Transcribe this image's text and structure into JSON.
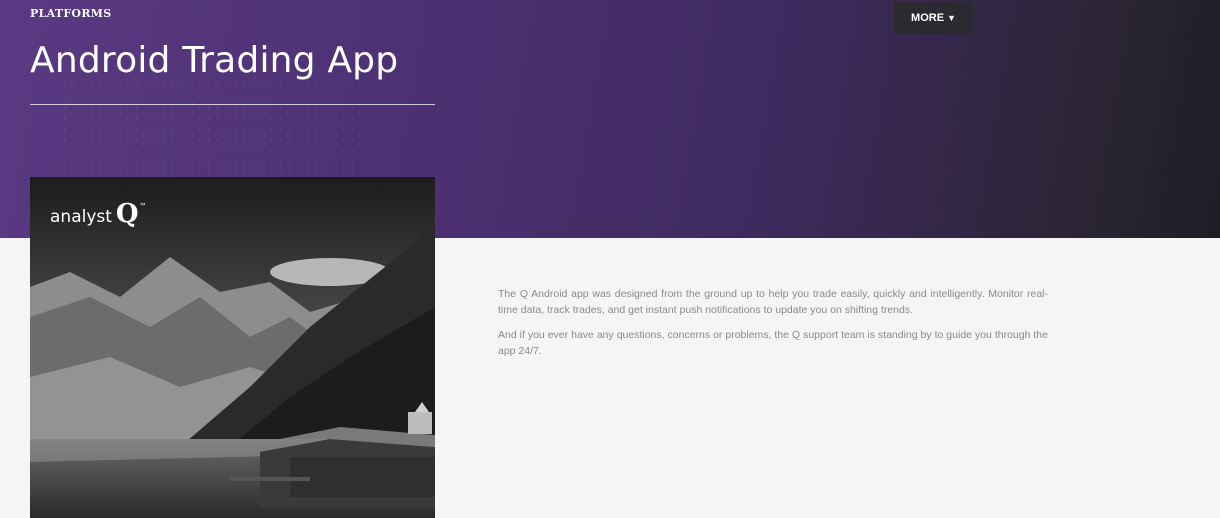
{
  "header": {
    "eyebrow": "PLATFORMS",
    "title": "Android Trading App",
    "more_label": "MORE",
    "more_icon": "chevron-down-icon"
  },
  "hero_image": {
    "logo_word": "analyst",
    "logo_mark": "Q",
    "logo_tm": "™"
  },
  "content": {
    "paragraphs": [
      "The Q Android app was designed from the ground up to help you trade easily, quickly and intelligently. Monitor real-time data, track trades, and get instant push notifications to update you on shifting trends.",
      "And if you ever have any questions, concerns or problems, the Q support team is standing by to guide you through the app 24/7."
    ]
  },
  "colors": {
    "hero_start": "#5a3a82",
    "hero_end": "#1f1d24",
    "more_button_bg": "#2c2a31",
    "body_text": "#8a8a8a",
    "page_bg": "#f5f5f5"
  }
}
